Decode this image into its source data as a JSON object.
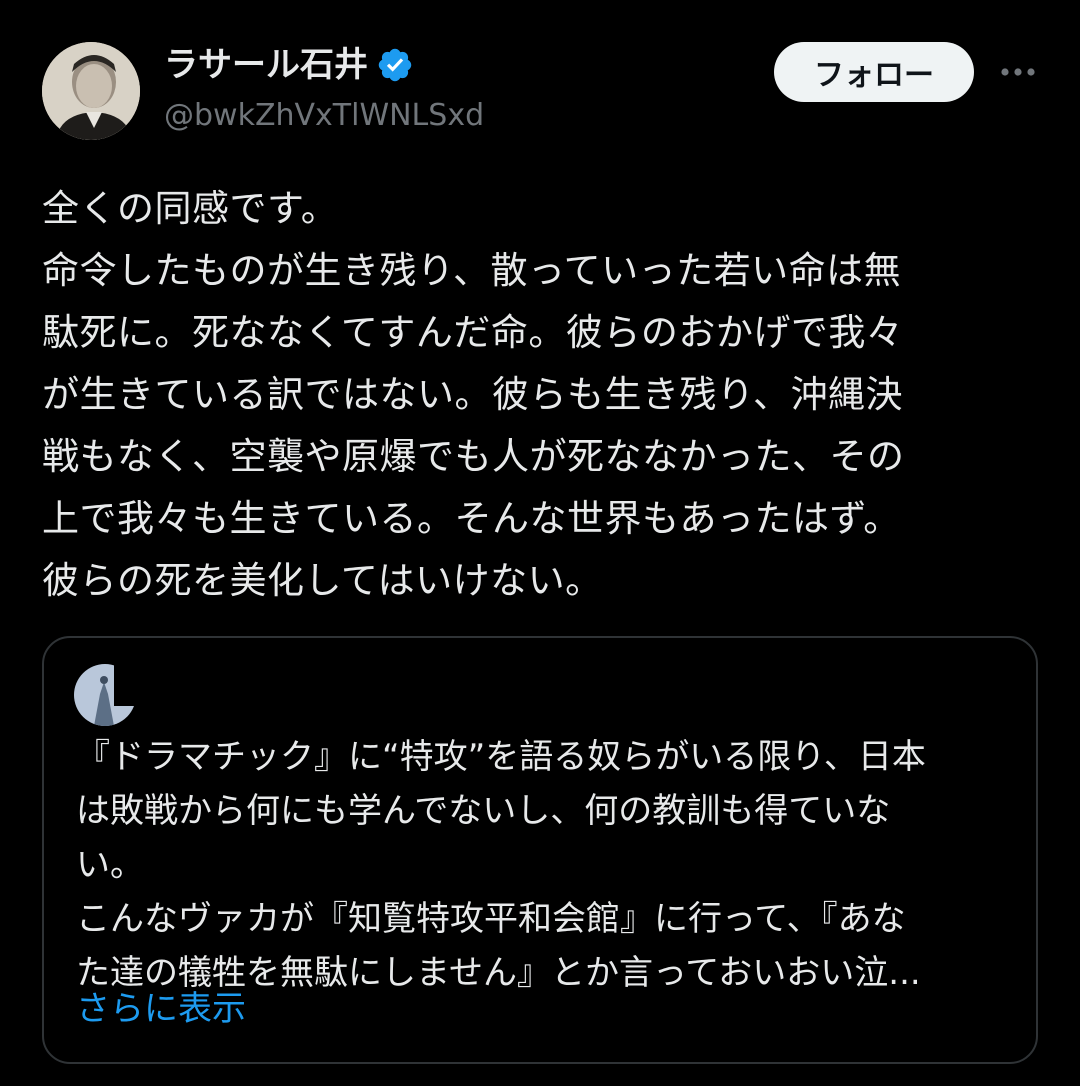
{
  "author": {
    "display_name": "ラサール石井",
    "handle": "@bwkZhVxTlWNLSxd",
    "verified": true
  },
  "actions": {
    "follow_label": "フォロー",
    "more_icon": "more-horizontal-icon"
  },
  "tweet": {
    "text": "全くの同感です。\n命令したものが生き残り、散っていった若い命は無\n駄死に。死ななくてすんだ命。彼らのおかげで我々\nが生きている訳ではない。彼らも生き残り、沖縄決\n戦もなく、空襲や原爆でも人が死ななかった、その\n上で我々も生きている。そんな世界もあったはず。\n彼らの死を美化してはいけない。"
  },
  "quoted_tweet": {
    "text": "『ドラマチック』に“特攻”を語る奴らがいる限り、日本\nは敗戦から何にも学んでないし、何の教訓も得ていな\nい。\nこんなヴァカが『知覧特攻平和会館』に行って、『あな\nた達の犠牲を無駄にしません』とか言っておいおい泣...",
    "show_more_label": "さらに表示"
  },
  "colors": {
    "background": "#000000",
    "text_primary": "#e7e9ea",
    "text_secondary": "#71767b",
    "accent": "#1d9bf0",
    "border": "#2f3336",
    "follow_bg": "#eff3f4"
  }
}
